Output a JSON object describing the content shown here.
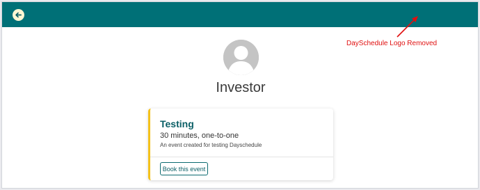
{
  "header": {
    "back_icon": "arrow-left-icon",
    "background_color": "#007077"
  },
  "profile": {
    "avatar_icon": "user-avatar-icon",
    "name": "Investor"
  },
  "event_card": {
    "title": "Testing",
    "duration": "30 minutes, one-to-one",
    "description": "An event created for testing Dayschedule",
    "book_label": "Book this event",
    "accent_color": "#f4c21b"
  },
  "annotation": {
    "text": "DaySchedule Logo Removed",
    "color": "#e01010"
  }
}
